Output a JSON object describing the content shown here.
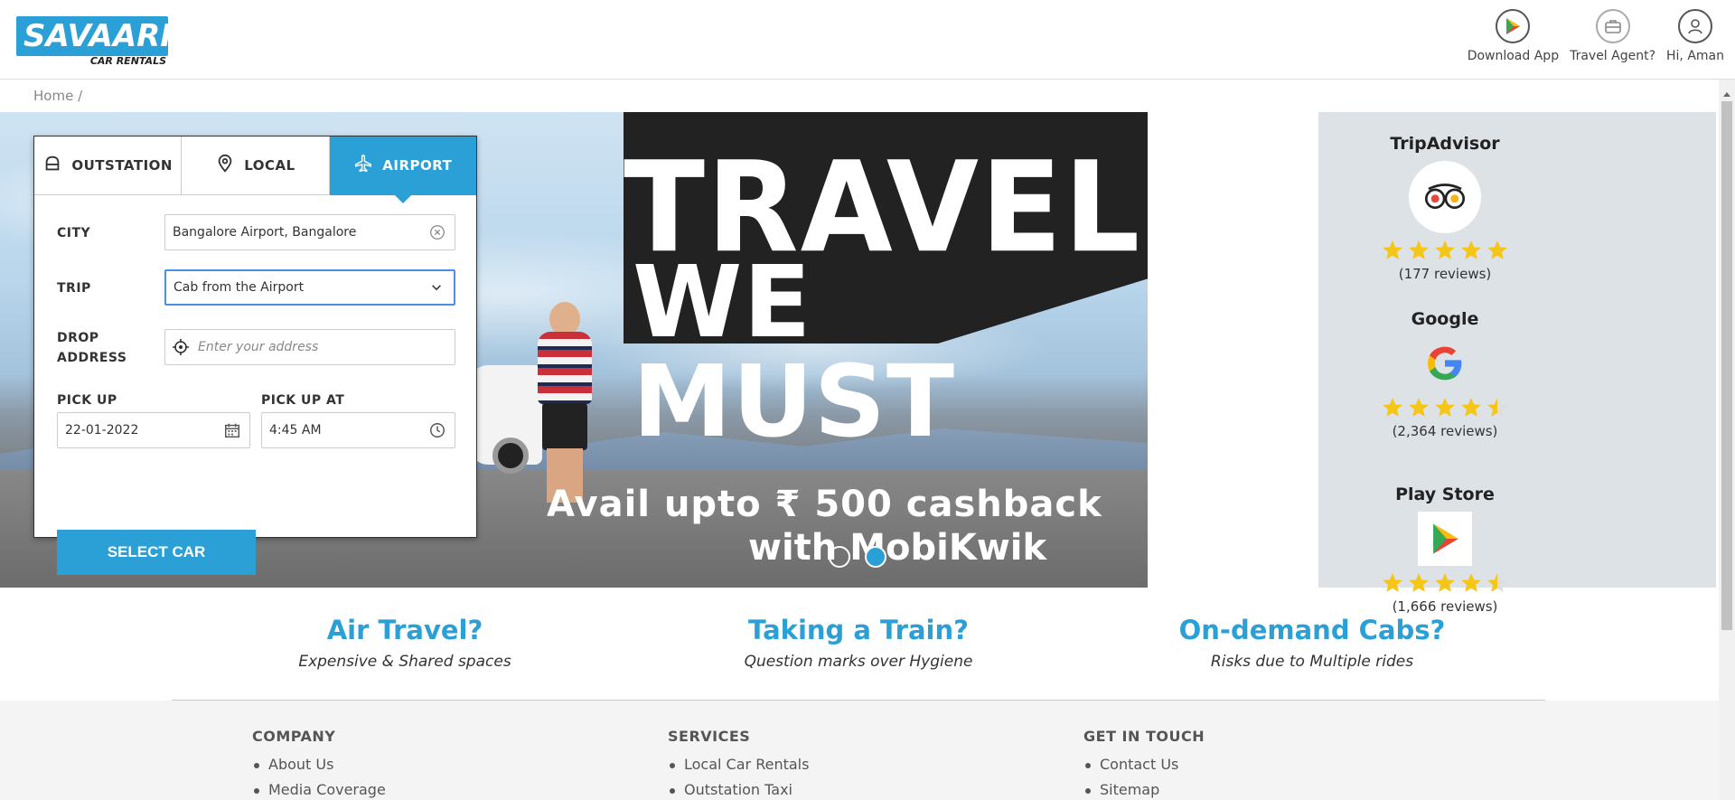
{
  "brand": {
    "name": "SAVAARI",
    "sub": "CAR RENTALS",
    "color": "#2aa0d6"
  },
  "header": {
    "actions": [
      {
        "label": "Download App",
        "icon": "play-store-icon"
      },
      {
        "label": "Travel Agent?",
        "icon": "briefcase-icon"
      },
      {
        "label": "Hi, Aman",
        "icon": "user-icon"
      }
    ]
  },
  "breadcrumb": "Home /",
  "booking": {
    "tabs": [
      {
        "label": "OUTSTATION",
        "icon": "car-front-icon"
      },
      {
        "label": "LOCAL",
        "icon": "location-pin-icon"
      },
      {
        "label": "AIRPORT",
        "icon": "airplane-icon",
        "active": true
      }
    ],
    "city_label": "CITY",
    "city_value": "Bangalore Airport, Bangalore",
    "trip_label": "TRIP",
    "trip_value": "Cab from the Airport",
    "drop_label_1": "DROP",
    "drop_label_2": "ADDRESS",
    "drop_placeholder": "Enter your address",
    "pickup_label": "PICK UP",
    "pickup_value": "22-01-2022",
    "pickup_at_label": "PICK UP AT",
    "pickup_at_value": "4:45 AM",
    "submit_label": "SELECT CAR"
  },
  "banner": {
    "title_1": "TRAVEL",
    "title_2": "WE MUST",
    "promo_1": "Avail upto ₹ 500 cashback",
    "promo_2": "with MobiKwik",
    "slides": 2,
    "active_slide": 2
  },
  "reviews": [
    {
      "source": "TripAdvisor",
      "rating": 5,
      "count": "(177 reviews)",
      "icon": "tripadvisor-owl-icon"
    },
    {
      "source": "Google",
      "rating": 4.5,
      "count": "(2,364 reviews)",
      "icon": "google-g-icon"
    },
    {
      "source": "Play Store",
      "rating": 4.5,
      "count": "(1,666 reviews)",
      "icon": "play-store-icon"
    }
  ],
  "features": [
    {
      "title": "Air Travel?",
      "sub": "Expensive & Shared spaces"
    },
    {
      "title": "Taking a Train?",
      "sub": "Question marks over Hygiene"
    },
    {
      "title": "On-demand Cabs?",
      "sub": "Risks due to Multiple rides"
    }
  ],
  "footer": {
    "columns": [
      {
        "heading": "COMPANY",
        "items": [
          "About Us",
          "Media Coverage"
        ]
      },
      {
        "heading": "SERVICES",
        "items": [
          "Local Car Rentals",
          "Outstation Taxi"
        ]
      },
      {
        "heading": "GET IN TOUCH",
        "items": [
          "Contact Us",
          "Sitemap"
        ]
      }
    ]
  },
  "colors": {
    "accent": "#2aa0d6",
    "star": "#f5c518",
    "panel": "#dde2e6"
  }
}
